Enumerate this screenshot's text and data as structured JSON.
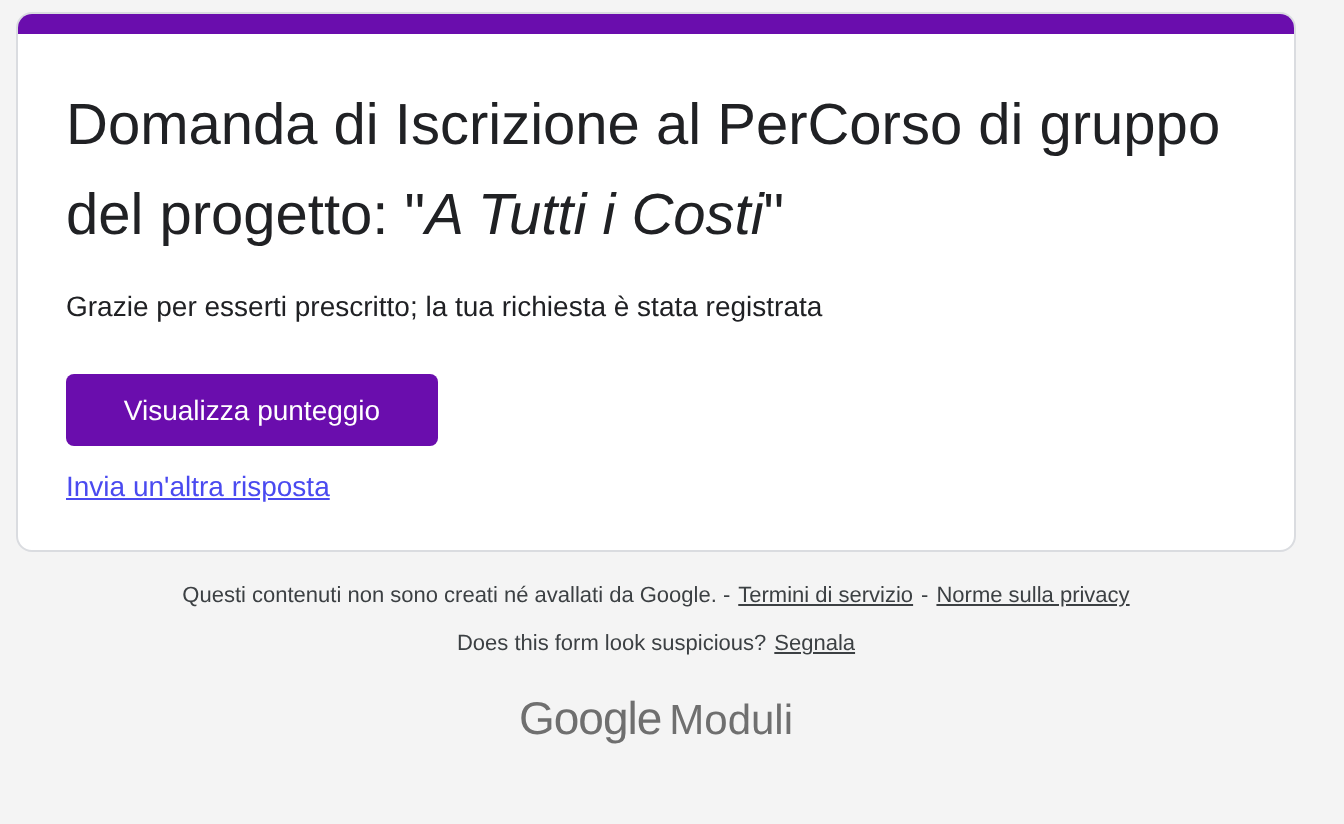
{
  "card": {
    "title": "Domanda di Iscrizione al PerCorso di gruppo del progetto: \"*A Tutti i Costi*\"",
    "message": "Grazie per esserti prescritto; la tua richiesta è stata registrata",
    "score_button": "Visualizza punteggio",
    "another_response_link": "Invia un'altra risposta"
  },
  "footer": {
    "notice": "Questi contenuti non sono creati né avallati da Google. -",
    "terms_link": "Termini di servizio",
    "separator": "-",
    "privacy_link": "Norme sulla privacy",
    "report_question": "Does this form look suspicious?",
    "report_link": "Segnala",
    "logo": {
      "brand": "Google",
      "product": "Moduli"
    }
  }
}
